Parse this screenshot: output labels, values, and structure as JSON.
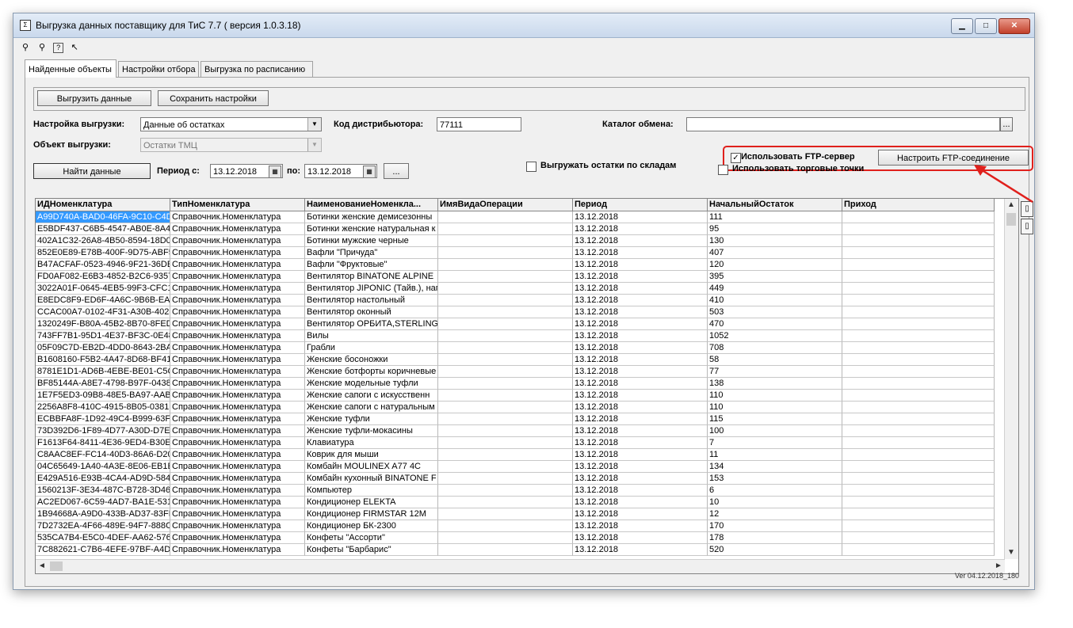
{
  "window": {
    "title": "Выгрузка данных поставщику для ТиС 7.7 ( версия 1.0.3.18)",
    "controls": {
      "minimize": "▁",
      "maximize": "□",
      "close": "✕"
    }
  },
  "toolbar": {
    "icons": [
      "network-icon",
      "network-icon",
      "help-icon",
      "whatsthis-icon"
    ]
  },
  "tabs": [
    {
      "label": "Найденные объекты"
    },
    {
      "label": "Настройки отбора"
    },
    {
      "label": "Выгрузка по расписанию"
    }
  ],
  "actions": {
    "export_label": "Выгрузить данные",
    "save_label": "Сохранить настройки"
  },
  "form": {
    "settings_label": "Настройка выгрузки:",
    "settings_value": "Данные об остатках",
    "distributor_label": "Код дистрибьютора:",
    "distributor_value": "77111",
    "catalog_label": "Каталог обмена:",
    "catalog_value": "",
    "object_label": "Объект выгрузки:",
    "object_value": "Остатки ТМЦ",
    "find_label": "Найти данные",
    "period_from_label": "Период с:",
    "period_from": "13.12.2018",
    "period_to_label": "по:",
    "period_to": "13.12.2018",
    "period_btn": "...",
    "use_ftp_label": "Использовать FTP-сервер",
    "use_ftp_checked": true,
    "ftp_config_label": "Настроить FTP-соединение",
    "by_warehouse_label": "Выгружать остатки по складам",
    "by_warehouse_checked": false,
    "trade_points_label": "Использовать торговые точки",
    "trade_points_checked": false
  },
  "grid": {
    "columns": [
      "ИДНоменклатура",
      "ТипНоменклатура",
      "НаименованиеНоменкла...",
      "ИмяВидаОперации",
      "Период",
      "НачальныйОстаток",
      "Приход"
    ],
    "rows": [
      [
        "A99D740A-BAD0-46FA-9C10-C4D",
        "Справочник.Номенклатура",
        "Ботинки женские демисезонны",
        "",
        "13.12.2018",
        "111",
        ""
      ],
      [
        "E5BDF437-C6B5-4547-AB0E-8A4!",
        "Справочник.Номенклатура",
        "Ботинки женские натуральная к",
        "",
        "13.12.2018",
        "95",
        ""
      ],
      [
        "402A1C32-26A8-4B50-8594-18D0",
        "Справочник.Номенклатура",
        "Ботинки мужские черные",
        "",
        "13.12.2018",
        "130",
        ""
      ],
      [
        "852E0E89-E78B-400F-9D75-ABF5",
        "Справочник.Номенклатура",
        "Вафли \"Причуда\"",
        "",
        "13.12.2018",
        "407",
        ""
      ],
      [
        "B47ACFAF-0523-4946-9F21-36DE",
        "Справочник.Номенклатура",
        "Вафли \"Фруктовые\"",
        "",
        "13.12.2018",
        "120",
        ""
      ],
      [
        "FD0AF082-E6B3-4852-B2C6-9357",
        "Справочник.Номенклатура",
        "Вентилятор BINATONE ALPINE",
        "",
        "13.12.2018",
        "395",
        ""
      ],
      [
        "3022A01F-0645-4EB5-99F3-CFC1",
        "Справочник.Номенклатура",
        "Вентилятор JIPONIC (Тайв.), наг",
        "",
        "13.12.2018",
        "449",
        ""
      ],
      [
        "E8EDC8F9-ED6F-4A6C-9B6B-EA(",
        "Справочник.Номенклатура",
        "Вентилятор настольный",
        "",
        "13.12.2018",
        "410",
        ""
      ],
      [
        "CCAC00A7-0102-4F31-A30B-4023",
        "Справочник.Номенклатура",
        "Вентилятор оконный",
        "",
        "13.12.2018",
        "503",
        ""
      ],
      [
        "1320249F-B80A-45B2-8B70-8FED",
        "Справочник.Номенклатура",
        "Вентилятор ОРБИТА,STERLING",
        "",
        "13.12.2018",
        "470",
        ""
      ],
      [
        "743FF7B1-95D1-4E37-BF3C-0E48",
        "Справочник.Номенклатура",
        "Вилы",
        "",
        "13.12.2018",
        "1052",
        ""
      ],
      [
        "05F09C7D-EB2D-4DD0-8643-2BA",
        "Справочник.Номенклатура",
        "Грабли",
        "",
        "13.12.2018",
        "708",
        ""
      ],
      [
        "B1608160-F5B2-4A47-8D68-BF41",
        "Справочник.Номенклатура",
        "Женские босоножки",
        "",
        "13.12.2018",
        "58",
        ""
      ],
      [
        "8781E1D1-AD6B-4EBE-BE01-C5C",
        "Справочник.Номенклатура",
        "Женские ботфорты коричневые",
        "",
        "13.12.2018",
        "77",
        ""
      ],
      [
        "BF85144A-A8E7-4798-B97F-0438",
        "Справочник.Номенклатура",
        "Женские модельные туфли",
        "",
        "13.12.2018",
        "138",
        ""
      ],
      [
        "1E7F5ED3-09B8-48E5-BA97-AAB",
        "Справочник.Номенклатура",
        "Женские сапоги с искусственн",
        "",
        "13.12.2018",
        "110",
        ""
      ],
      [
        "2256A8F8-410C-4915-8B05-0381!",
        "Справочник.Номенклатура",
        "Женские сапоги с натуральным",
        "",
        "13.12.2018",
        "110",
        ""
      ],
      [
        "ECBBFA8F-1D92-49C4-B999-63F8",
        "Справочник.Номенклатура",
        "Женские туфли",
        "",
        "13.12.2018",
        "115",
        ""
      ],
      [
        "73D392D6-1F89-4D77-A30D-D7E",
        "Справочник.Номенклатура",
        "Женские туфли-мокасины",
        "",
        "13.12.2018",
        "100",
        ""
      ],
      [
        "F1613F64-8411-4E36-9ED4-B30E",
        "Справочник.Номенклатура",
        "Клавиатура",
        "",
        "13.12.2018",
        "7",
        ""
      ],
      [
        "C8AAC8EF-FC14-40D3-86A6-D20",
        "Справочник.Номенклатура",
        "Коврик для мыши",
        "",
        "13.12.2018",
        "11",
        ""
      ],
      [
        "04C65649-1A40-4A3E-8E06-EB1E",
        "Справочник.Номенклатура",
        "Комбайн MOULINEX A77 4C",
        "",
        "13.12.2018",
        "134",
        ""
      ],
      [
        "E429A516-E93B-4CA4-AD9D-584",
        "Справочник.Номенклатура",
        "Комбайн кухонный BINATONE F",
        "",
        "13.12.2018",
        "153",
        ""
      ],
      [
        "1560213F-3E34-487C-B728-3D46",
        "Справочник.Номенклатура",
        "Компьютер",
        "",
        "13.12.2018",
        "6",
        ""
      ],
      [
        "AC2ED067-6C59-4AD7-BA1E-531",
        "Справочник.Номенклатура",
        "Кондиционер ELEKTA",
        "",
        "13.12.2018",
        "10",
        ""
      ],
      [
        "1B94668A-A9D0-433B-AD37-83FE",
        "Справочник.Номенклатура",
        "Кондиционер FIRMSTAR 12M",
        "",
        "13.12.2018",
        "12",
        ""
      ],
      [
        "7D2732EA-4F66-489E-94F7-888C",
        "Справочник.Номенклатура",
        "Кондиционер БК-2300",
        "",
        "13.12.2018",
        "170",
        ""
      ],
      [
        "535CA7B4-E5C0-4DEF-AA62-576!",
        "Справочник.Номенклатура",
        "Конфеты \"Ассорти\"",
        "",
        "13.12.2018",
        "178",
        ""
      ],
      [
        "7C882621-C7B6-4EFE-97BF-A4DE",
        "Справочник.Номенклатура",
        "Конфеты \"Барбарис\"",
        "",
        "13.12.2018",
        "520",
        ""
      ]
    ]
  },
  "scroll": {
    "up": "▲",
    "down": "▼",
    "left": "◄",
    "right": "►"
  },
  "side_buttons": [
    "▯",
    "▯"
  ],
  "footer": {
    "version": "Ver 04.12.2018_180"
  }
}
